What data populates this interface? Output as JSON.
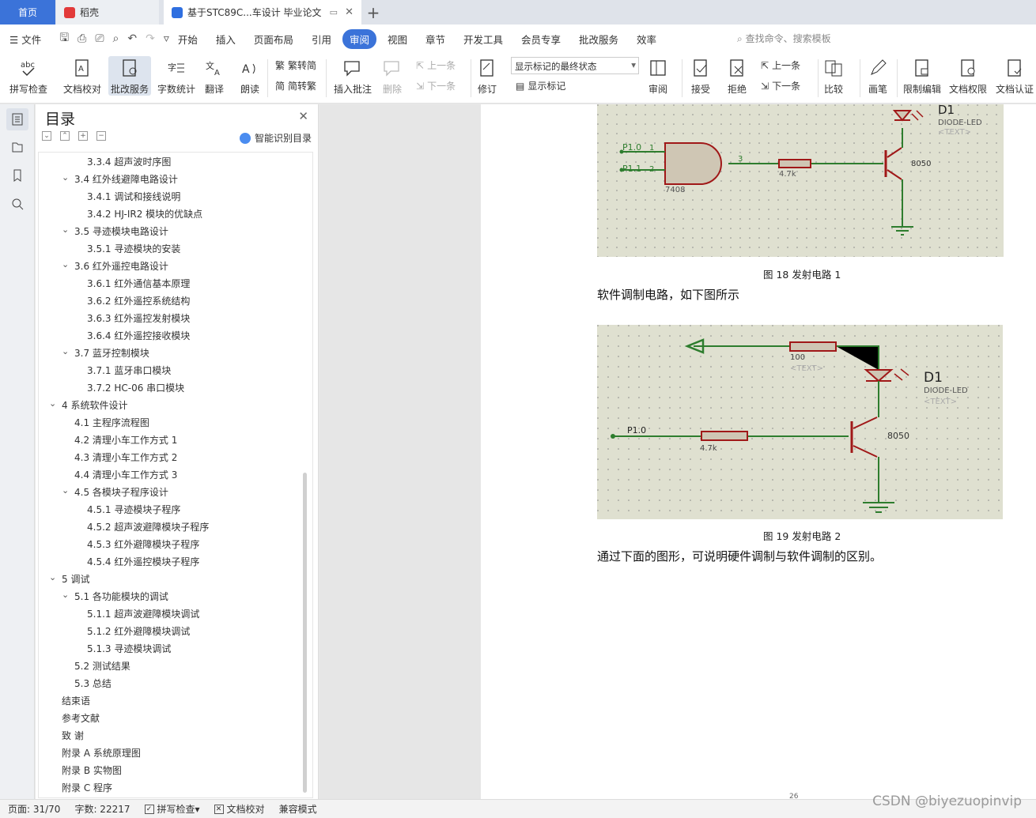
{
  "tabs": {
    "home": "首页",
    "daoke": "稻壳",
    "doc": "基于STC89C...车设计 毕业论文"
  },
  "menubar": {
    "file": "文件",
    "items": [
      "开始",
      "插入",
      "页面布局",
      "引用",
      "审阅",
      "视图",
      "章节",
      "开发工具",
      "会员专享",
      "批改服务",
      "效率"
    ],
    "active_index": 4,
    "search": "查找命令、搜索模板"
  },
  "ribbon": {
    "spell": "拼写检查",
    "proof": "文档校对",
    "revise_service": "批改服务",
    "word_count": "字数统计",
    "translate": "翻译",
    "read": "朗读",
    "trad": "繁转简",
    "simp": "简转繁",
    "insert_comment": "插入批注",
    "delete": "删除",
    "prev": "上一条",
    "next": "下一条",
    "track": "修订",
    "show_final": "显示标记的最终状态",
    "show_marks": "显示标记",
    "review": "审阅",
    "accept": "接受",
    "reject": "拒绝",
    "prev2": "上一条",
    "next2": "下一条",
    "compare": "比较",
    "brush": "画笔",
    "restrict": "限制编辑",
    "doc_perm": "文档权限",
    "doc_cert": "文档认证"
  },
  "toc": {
    "title": "目录",
    "ai": "智能识别目录",
    "items": [
      {
        "text": "3.3.4  超声波时序图",
        "lvl": 3,
        "arrow": ""
      },
      {
        "text": "3.4  红外线避障电路设计",
        "lvl": 2,
        "arrow": "⌄"
      },
      {
        "text": "3.4.1  调试和接线说明",
        "lvl": 3,
        "arrow": ""
      },
      {
        "text": "3.4.2 HJ-IR2 模块的优缺点",
        "lvl": 3,
        "arrow": ""
      },
      {
        "text": "3.5  寻迹模块电路设计",
        "lvl": 2,
        "arrow": "⌄"
      },
      {
        "text": "3.5.1  寻迹模块的安装",
        "lvl": 3,
        "arrow": ""
      },
      {
        "text": "3.6  红外遥控电路设计",
        "lvl": 2,
        "arrow": "⌄"
      },
      {
        "text": "3.6.1  红外通信基本原理",
        "lvl": 3,
        "arrow": ""
      },
      {
        "text": "3.6.2  红外遥控系统结构",
        "lvl": 3,
        "arrow": ""
      },
      {
        "text": "3.6.3  红外遥控发射模块",
        "lvl": 3,
        "arrow": ""
      },
      {
        "text": "3.6.4  红外遥控接收模块",
        "lvl": 3,
        "arrow": ""
      },
      {
        "text": "3.7  蓝牙控制模块",
        "lvl": 2,
        "arrow": "⌄"
      },
      {
        "text": "3.7.1  蓝牙串口模块",
        "lvl": 3,
        "arrow": ""
      },
      {
        "text": "3.7.2 HC-06 串口模块",
        "lvl": 3,
        "arrow": ""
      },
      {
        "text": "4  系统软件设计",
        "lvl": 1,
        "arrow": "⌄"
      },
      {
        "text": "4.1  主程序流程图",
        "lvl": 2,
        "arrow": ""
      },
      {
        "text": "4.2  清理小车工作方式 1",
        "lvl": 2,
        "arrow": ""
      },
      {
        "text": "4.3  清理小车工作方式 2",
        "lvl": 2,
        "arrow": ""
      },
      {
        "text": "4.4  清理小车工作方式 3",
        "lvl": 2,
        "arrow": ""
      },
      {
        "text": "4.5  各模块子程序设计",
        "lvl": 2,
        "arrow": "⌄"
      },
      {
        "text": "4.5.1  寻迹模块子程序",
        "lvl": 3,
        "arrow": ""
      },
      {
        "text": "4.5.2  超声波避障模块子程序",
        "lvl": 3,
        "arrow": ""
      },
      {
        "text": "4.5.3  红外避障模块子程序",
        "lvl": 3,
        "arrow": ""
      },
      {
        "text": "4.5.4  红外遥控模块子程序",
        "lvl": 3,
        "arrow": ""
      },
      {
        "text": "5  调试",
        "lvl": 1,
        "arrow": "⌄"
      },
      {
        "text": "5.1  各功能模块的调试",
        "lvl": 2,
        "arrow": "⌄"
      },
      {
        "text": "5.1.1  超声波避障模块调试",
        "lvl": 3,
        "arrow": ""
      },
      {
        "text": "5.1.2  红外避障模块调试",
        "lvl": 3,
        "arrow": ""
      },
      {
        "text": "5.1.3  寻迹模块调试",
        "lvl": 3,
        "arrow": ""
      },
      {
        "text": "5.2  测试结果",
        "lvl": 2,
        "arrow": ""
      },
      {
        "text": "5.3  总结",
        "lvl": 2,
        "arrow": ""
      },
      {
        "text": "结束语",
        "lvl": 1,
        "arrow": ""
      },
      {
        "text": "参考文献",
        "lvl": 1,
        "arrow": ""
      },
      {
        "text": "致    谢",
        "lvl": 1,
        "arrow": ""
      },
      {
        "text": "附录 A    系统原理图",
        "lvl": 1,
        "arrow": ""
      },
      {
        "text": "附录 B    实物图",
        "lvl": 1,
        "arrow": ""
      },
      {
        "text": "附录 C    程序",
        "lvl": 1,
        "arrow": ""
      }
    ]
  },
  "doc": {
    "fig18": {
      "caption": "图 18  发射电路 1",
      "p10": "P1.0",
      "p11": "P1.1",
      "n1": "1",
      "n2": "2",
      "n3": "3",
      "chip": "7408",
      "res": "4.7k",
      "d1": "D1",
      "led": "DIODE-LED",
      "text": "<TEXT>",
      "tr": "8050"
    },
    "para1": "软件调制电路，如下图所示",
    "fig19": {
      "caption": "图 19  发射电路 2",
      "p10": "P1.0",
      "r1": "100",
      "text1": "<TEXT>",
      "res": "4.7k",
      "d1": "D1",
      "led": "DIODE-LED",
      "text2": "<TEXT>",
      "tr": "8050"
    },
    "para2": "通过下面的图形，可说明硬件调制与软件调制的区别。",
    "page_number": "26"
  },
  "status": {
    "page": "页面: 31/70",
    "words": "字数: 22217",
    "spell": "拼写检查",
    "proof": "文档校对",
    "compat": "兼容模式"
  },
  "watermark": "CSDN @biyezuopinvip",
  "colors": {
    "accent": "#3b73d9",
    "wire_green": "#2e7d2e",
    "component_red": "#a01818",
    "schematic_bg": "#dfe0d0"
  }
}
